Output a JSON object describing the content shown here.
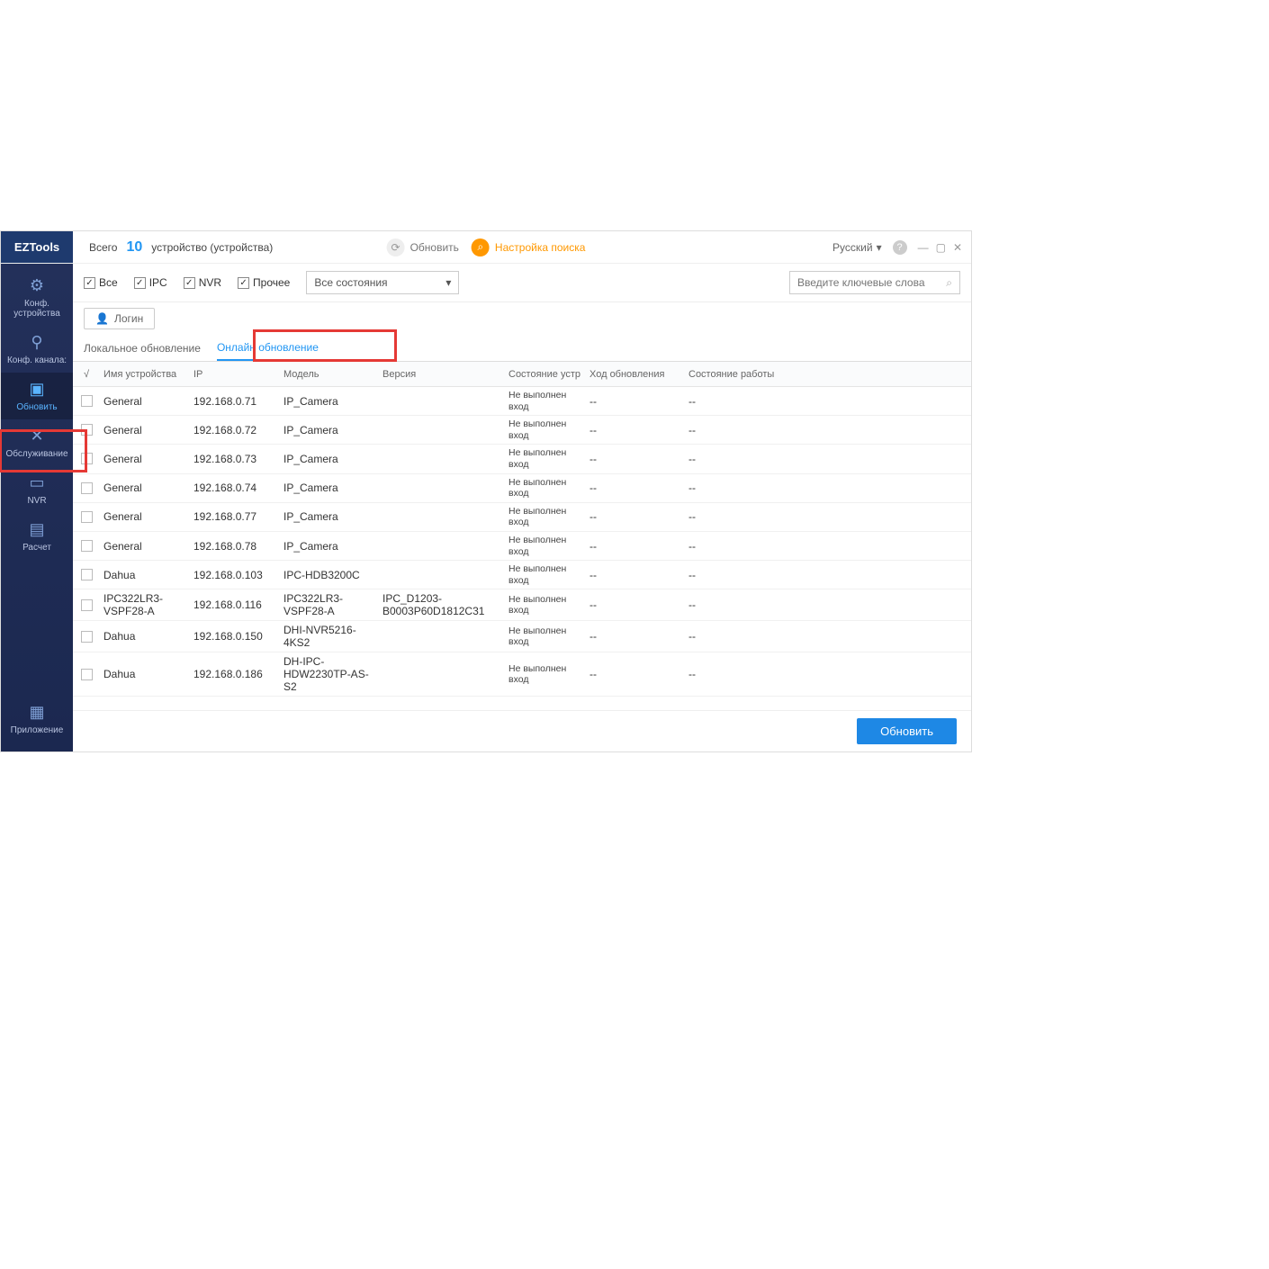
{
  "app_title": "EZTools",
  "topbar": {
    "total_label": "Всего",
    "total_count": "10",
    "devices_label": "устройство (устройства)",
    "refresh_label": "Обновить",
    "search_settings_label": "Настройка поиска",
    "language": "Русский"
  },
  "sidebar": {
    "items": [
      {
        "label": "Конф. устройства"
      },
      {
        "label": "Конф. канала:"
      },
      {
        "label": "Обновить"
      },
      {
        "label": "Обслуживание"
      },
      {
        "label": "NVR"
      },
      {
        "label": "Расчет"
      }
    ],
    "bottom": {
      "label": "Приложение"
    }
  },
  "filters": {
    "all": "Все",
    "ipc": "IPC",
    "nvr": "NVR",
    "other": "Прочее",
    "status_select": "Все состояния",
    "search_placeholder": "Введите ключевые слова"
  },
  "login_label": "Логин",
  "tabs": {
    "local": "Локальное обновление",
    "online": "Онлайн обновление"
  },
  "columns": {
    "name": "Имя устройства",
    "ip": "IP",
    "model": "Модель",
    "version": "Версия",
    "dev_status": "Состояние устр",
    "update_progress": "Ход обновления",
    "work_status": "Состояние работы"
  },
  "rows": [
    {
      "name": "General",
      "ip": "192.168.0.71",
      "model": "IP_Camera",
      "version": "",
      "dev_status": "Не выполнен вход",
      "update": "--",
      "work": "--"
    },
    {
      "name": "General",
      "ip": "192.168.0.72",
      "model": "IP_Camera",
      "version": "",
      "dev_status": "Не выполнен вход",
      "update": "--",
      "work": "--"
    },
    {
      "name": "General",
      "ip": "192.168.0.73",
      "model": "IP_Camera",
      "version": "",
      "dev_status": "Не выполнен вход",
      "update": "--",
      "work": "--"
    },
    {
      "name": "General",
      "ip": "192.168.0.74",
      "model": "IP_Camera",
      "version": "",
      "dev_status": "Не выполнен вход",
      "update": "--",
      "work": "--"
    },
    {
      "name": "General",
      "ip": "192.168.0.77",
      "model": "IP_Camera",
      "version": "",
      "dev_status": "Не выполнен вход",
      "update": "--",
      "work": "--"
    },
    {
      "name": "General",
      "ip": "192.168.0.78",
      "model": "IP_Camera",
      "version": "",
      "dev_status": "Не выполнен вход",
      "update": "--",
      "work": "--"
    },
    {
      "name": "Dahua",
      "ip": "192.168.0.103",
      "model": "IPC-HDB3200C",
      "version": "",
      "dev_status": "Не выполнен вход",
      "update": "--",
      "work": "--"
    },
    {
      "name": "IPC322LR3-VSPF28-A",
      "ip": "192.168.0.116",
      "model": "IPC322LR3-VSPF28-A",
      "version": "IPC_D1203-B0003P60D1812C31",
      "dev_status": "Не выполнен вход",
      "update": "--",
      "work": "--"
    },
    {
      "name": "Dahua",
      "ip": "192.168.0.150",
      "model": "DHI-NVR5216-4KS2",
      "version": "",
      "dev_status": "Не выполнен вход",
      "update": "--",
      "work": "--"
    },
    {
      "name": "Dahua",
      "ip": "192.168.0.186",
      "model": "DH-IPC-HDW2230TP-AS-S2",
      "version": "",
      "dev_status": "Не выполнен вход",
      "update": "--",
      "work": "--"
    }
  ],
  "footer": {
    "update_btn": "Обновить"
  }
}
